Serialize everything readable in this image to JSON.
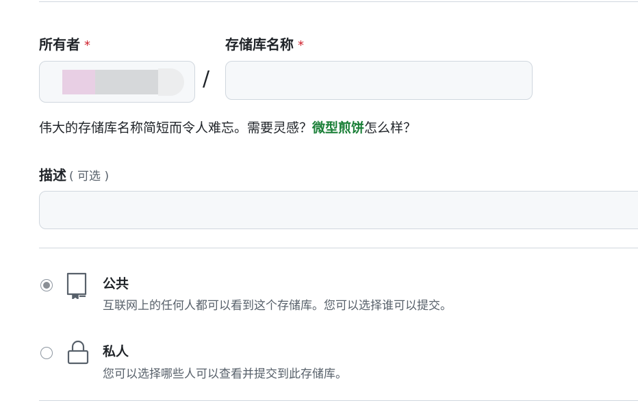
{
  "owner": {
    "label": "所有者",
    "required_mark": "*"
  },
  "repository_name": {
    "label": "存储库名称",
    "required_mark": "*",
    "separator": "/",
    "value": ""
  },
  "name_hint": {
    "text_before": "伟大的存储库名称简短而令人难忘。需要灵感？",
    "suggestion": "微型煎饼",
    "text_after": "怎么样？"
  },
  "description": {
    "label": "描述",
    "optional_text": "( 可选 )",
    "value": ""
  },
  "visibility": {
    "selected": "public",
    "options": [
      {
        "id": "public",
        "title": "公共",
        "description": "互联网上的任何人都可以看到这个存储库。您可以选择谁可以提交。",
        "icon": "repo-icon"
      },
      {
        "id": "private",
        "title": "私人",
        "description": "您可以选择哪些人可以查看并提交到此存储库。",
        "icon": "lock-icon"
      }
    ]
  },
  "colors": {
    "required": "#cf222e",
    "link": "#1a7f37",
    "input_bg": "#f6f8fa",
    "border": "#d0d7de"
  }
}
